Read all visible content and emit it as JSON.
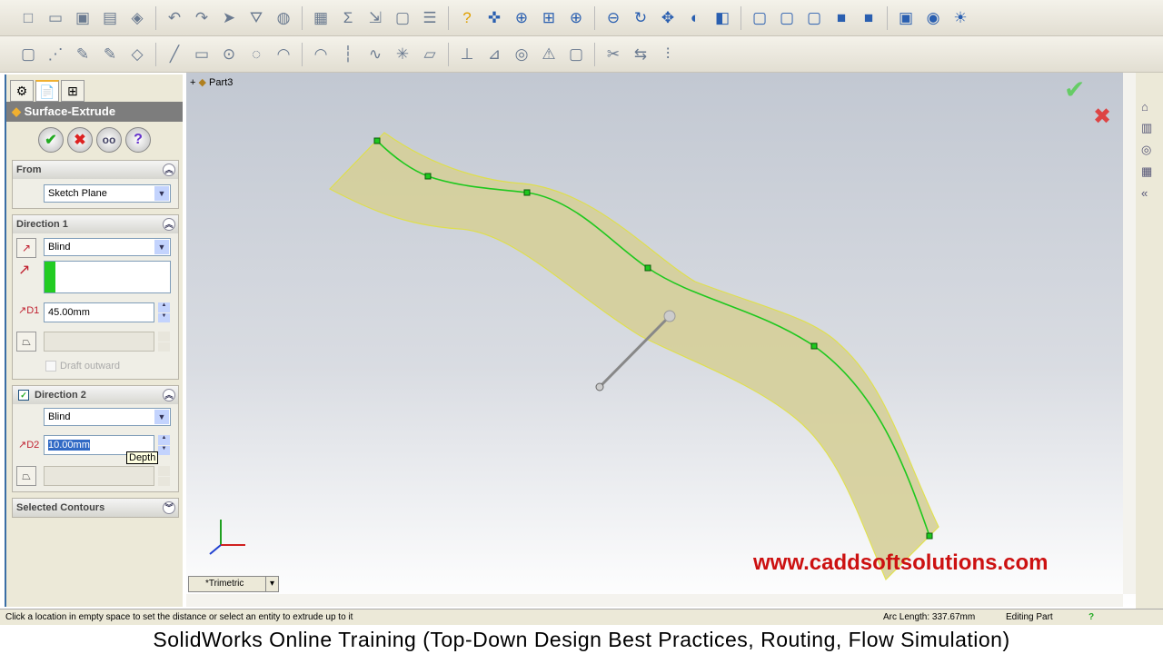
{
  "toolbar1": {
    "icons": [
      "new-icon",
      "open-icon",
      "save-icon",
      "print-icon",
      "options-icon",
      "undo-icon",
      "redo-icon",
      "select-icon",
      "filter-icon",
      "rebuild-icon",
      "grid-icon",
      "sigma-icon",
      "dimension-icon",
      "sheet-icon",
      "list-icon",
      "help-icon",
      "view-orientation-icon",
      "zoom-fit-icon",
      "zoom-area-icon",
      "zoom-in-icon",
      "zoom-out-icon",
      "rotate-icon",
      "pan-icon",
      "3d-icon",
      "section-view-icon",
      "wireframe-icon",
      "hidden-lines-icon",
      "hidden-removed-icon",
      "shaded-edges-icon",
      "shaded-icon",
      "perspective-icon",
      "realview-icon",
      "lights-icon"
    ]
  },
  "toolbar2": {
    "icons": [
      "sketch-icon",
      "smart-dimension-icon",
      "pencil-icon",
      "3d-sketch-icon",
      "eraser-icon",
      "line-icon",
      "rectangle-icon",
      "circle-icon",
      "arc-icon",
      "tangent-arc-icon",
      "three-point-arc-icon",
      "centerline-icon",
      "spline-icon",
      "point-icon",
      "plane-icon",
      "fix-icon",
      "relation-icon",
      "offset-icon",
      "warning-icon",
      "convert-icon",
      "trim-icon",
      "extend-icon",
      "mirror-icon"
    ]
  },
  "panel": {
    "tabs": [
      "feature-manager",
      "property-manager",
      "configuration-manager"
    ],
    "title": "Surface-Extrude",
    "from": {
      "label": "From",
      "value": "Sketch Plane"
    },
    "dir1": {
      "label": "Direction 1",
      "type": "Blind",
      "depth": "45.00mm",
      "draft": "Draft outward"
    },
    "dir2": {
      "label": "Direction 2",
      "checked": true,
      "type": "Blind",
      "depth": "10.00mm",
      "tooltip": "Depth"
    },
    "contours": {
      "label": "Selected Contours"
    }
  },
  "viewport": {
    "tree": "Part3",
    "view": "*Trimetric",
    "watermark": "www.caddsoftsolutions.com",
    "surface_color": "#d8d29a",
    "curve_color": "#1ec81e"
  },
  "status": {
    "message": "Click a location in empty space to set the distance or select an entity to extrude up to it",
    "arc_length": "Arc Length: 337.67mm",
    "mode": "Editing Part",
    "help": "?"
  },
  "caption": "SolidWorks Online Training (Top-Down Design Best Practices, Routing, Flow Simulation)"
}
